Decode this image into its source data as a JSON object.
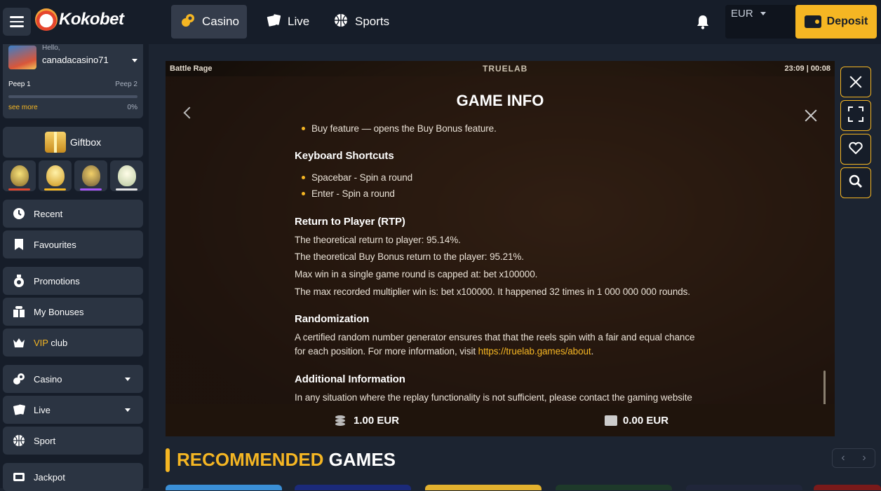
{
  "brand": {
    "name": "Kokobet"
  },
  "user": {
    "greeting": "Hello,",
    "username": "canadacasino71",
    "level_current": "Peep 1",
    "level_next": "Peep 2",
    "progress_percent": 0,
    "progress_label": "0%",
    "see_more": "see more"
  },
  "sidebar": {
    "giftbox_label": "Giftbox",
    "eggs": [
      {
        "name": "basket-egg-icon",
        "color": "#e0452d"
      },
      {
        "name": "trophy-egg-icon",
        "color": "#f5b623"
      },
      {
        "name": "purple-egg-icon",
        "color": "#a855f7"
      },
      {
        "name": "white-egg-icon",
        "color": "#e6e6e6"
      }
    ],
    "items": [
      {
        "label": "Recent"
      },
      {
        "label": "Favourites"
      },
      {
        "label": "Promotions"
      },
      {
        "label": "My Bonuses"
      },
      {
        "label_vip": "VIP",
        "label_rest": " club"
      },
      {
        "label": "Casino"
      },
      {
        "label": "Live"
      },
      {
        "label": "Sport"
      },
      {
        "label": "Jackpot"
      }
    ]
  },
  "topbar": {
    "tabs": [
      {
        "label": "Casino",
        "active": true
      },
      {
        "label": "Live"
      },
      {
        "label": "Sports"
      }
    ],
    "currency": "EUR",
    "deposit_label": "Deposit"
  },
  "game": {
    "title": "Battle Rage",
    "provider": "TRUELAB",
    "time": "23:09 | 00:08",
    "info_title": "GAME INFO",
    "bullets_top": [
      "Buy feature — opens the Buy Bonus feature."
    ],
    "keyboard_heading": "Keyboard Shortcuts",
    "keyboard_items": [
      "Spacebar - Spin a round",
      "Enter - Spin a round"
    ],
    "rtp_heading": "Return to Player (RTP)",
    "rtp_lines": [
      "The theoretical return to player: 95.14%.",
      "The theoretical Buy Bonus return to the player: 95.21%.",
      "Max win in a single game round is capped at: bet x100000.",
      "The max recorded multiplier win is: bet x100000. It happened 32 times in 1 000 000 000 rounds."
    ],
    "random_heading": "Randomization",
    "random_line1": "A certified random number generator ensures that that the reels spin with a fair and equal chance",
    "random_line2_pre": "for each position. For more information, visit ",
    "random_link": "https://truelab.games/about",
    "random_line2_post": ".",
    "additional_heading": "Additional Information",
    "additional_line": "In any situation where the replay functionality is not sufficient, please contact the gaming website",
    "bet": "1.00 EUR",
    "balance": "0.00 EUR"
  },
  "recommended": {
    "title_accent": "RECOMMENDED",
    "title_rest": " GAMES"
  }
}
